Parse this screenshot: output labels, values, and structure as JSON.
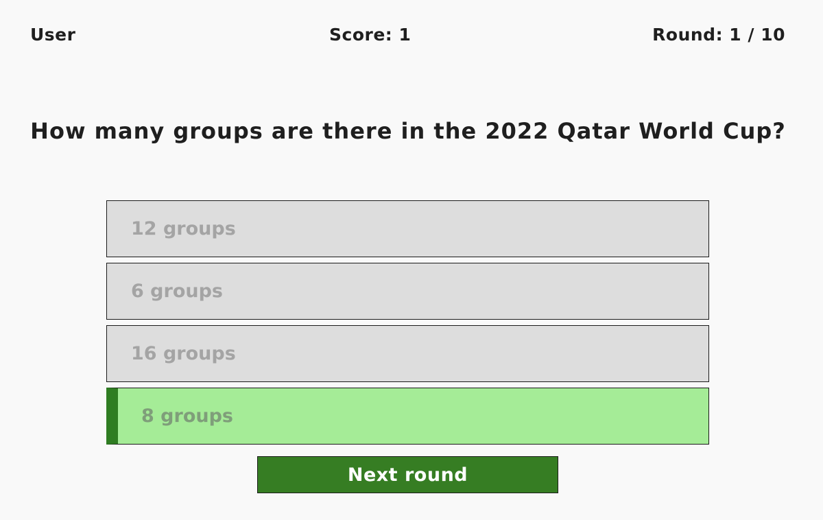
{
  "header": {
    "user": "User",
    "score": "Score: 1",
    "round": "Round: 1 / 10"
  },
  "question": "How many groups are there in the 2022 Qatar World Cup?",
  "answers": [
    {
      "label": "12 groups",
      "state": "neutral"
    },
    {
      "label": "6 groups",
      "state": "neutral"
    },
    {
      "label": "16 groups",
      "state": "neutral"
    },
    {
      "label": "8 groups",
      "state": "correct"
    }
  ],
  "next_button": "Next round",
  "colors": {
    "background": "#f9f9f9",
    "answer_neutral": "#dddddd",
    "answer_correct": "#a5ec97",
    "answer_correct_accent": "#2f7d22",
    "button": "#367d23"
  }
}
